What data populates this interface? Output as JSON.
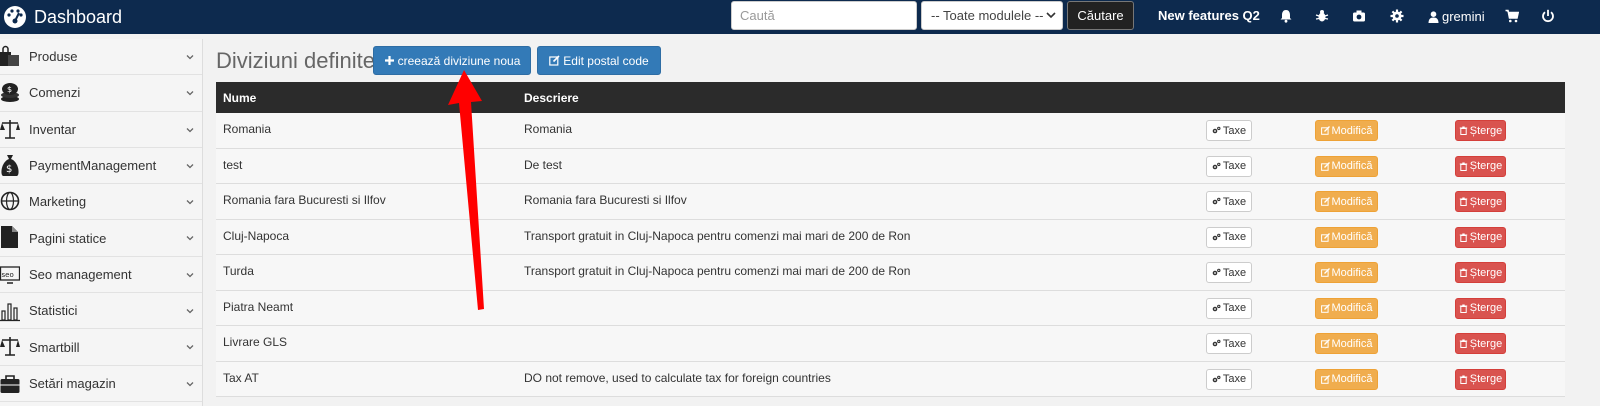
{
  "topbar": {
    "title": "Dashboard",
    "search_placeholder": "Caută",
    "module_select_value": "-- Toate modulele --",
    "search_button": "Căutare",
    "new_features": "New features Q2",
    "username": "gremini",
    "icons": [
      "bell-icon",
      "bug-icon",
      "camera-icon",
      "gear-icon",
      "user-icon",
      "cart-icon",
      "power-icon"
    ]
  },
  "sidebar": {
    "items": [
      {
        "label": "Produse",
        "icon": "shopping-bags-icon"
      },
      {
        "label": "Comenzi",
        "icon": "coins-icon"
      },
      {
        "label": "Inventar",
        "icon": "scale-icon"
      },
      {
        "label": "PaymentManagement",
        "icon": "money-bag-icon"
      },
      {
        "label": "Marketing",
        "icon": "globe-icon"
      },
      {
        "label": "Pagini statice",
        "icon": "document-icon"
      },
      {
        "label": "Seo management",
        "icon": "seo-icon"
      },
      {
        "label": "Statistici",
        "icon": "bar-chart-icon"
      },
      {
        "label": "Smartbill",
        "icon": "scale-icon"
      },
      {
        "label": "Setări magazin",
        "icon": "briefcase-icon"
      }
    ]
  },
  "main": {
    "title": "Diviziuni definite",
    "create_button": "creează diviziune noua",
    "edit_postal_button": "Edit postal code",
    "table": {
      "headers": [
        "Nume",
        "Descriere"
      ],
      "action_labels": {
        "tax": "Taxe",
        "modify": "Modifică",
        "delete": "Șterge"
      },
      "rows": [
        {
          "name": "Romania",
          "description": "Romania"
        },
        {
          "name": "test",
          "description": "De test"
        },
        {
          "name": "Romania fara Bucuresti si Ilfov",
          "description": "Romania fara Bucuresti si Ilfov"
        },
        {
          "name": "Cluj-Napoca",
          "description": "Transport gratuit in Cluj-Napoca pentru comenzi mai mari de 200 de Ron"
        },
        {
          "name": "Turda",
          "description": "Transport gratuit in Cluj-Napoca pentru comenzi mai mari de 200 de Ron"
        },
        {
          "name": "Piatra Neamt",
          "description": ""
        },
        {
          "name": "Livrare GLS",
          "description": ""
        },
        {
          "name": "Tax AT",
          "description": "DO not remove, used to calculate tax for foreign countries"
        }
      ]
    }
  },
  "colors": {
    "topbar": "#0d2a4e",
    "primary": "#337ab7",
    "warning": "#f0ad4e",
    "danger": "#d9534f",
    "table_header": "#2b2b2b",
    "annotation_arrow": "#ff0000"
  }
}
